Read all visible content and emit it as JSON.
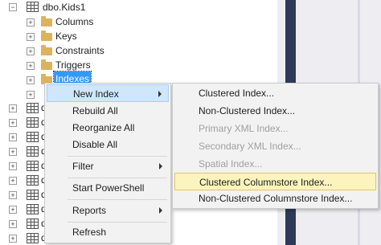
{
  "tree": {
    "root": "dbo.Kids1",
    "children": [
      "Columns",
      "Keys",
      "Constraints",
      "Triggers"
    ],
    "selected": "Indexes",
    "collapsed_rows": [
      "d",
      "d",
      "d",
      "d",
      "d",
      "d",
      "d",
      "d",
      "d",
      "d",
      "d",
      "d"
    ]
  },
  "context_menu": {
    "items": [
      "New Index",
      "Rebuild All",
      "Reorganize All",
      "Disable All",
      "Filter",
      "Start PowerShell",
      "Reports",
      "Refresh"
    ]
  },
  "submenu": {
    "items": [
      {
        "label": "Clustered Index...",
        "enabled": true
      },
      {
        "label": "Non-Clustered Index...",
        "enabled": true
      },
      {
        "label": "Primary XML Index...",
        "enabled": false
      },
      {
        "label": "Secondary XML Index...",
        "enabled": false
      },
      {
        "label": "Spatial Index...",
        "enabled": false
      },
      {
        "label": "Clustered Columnstore Index...",
        "enabled": true
      },
      {
        "label": "Non-Clustered Columnstore Index...",
        "enabled": true
      }
    ]
  }
}
